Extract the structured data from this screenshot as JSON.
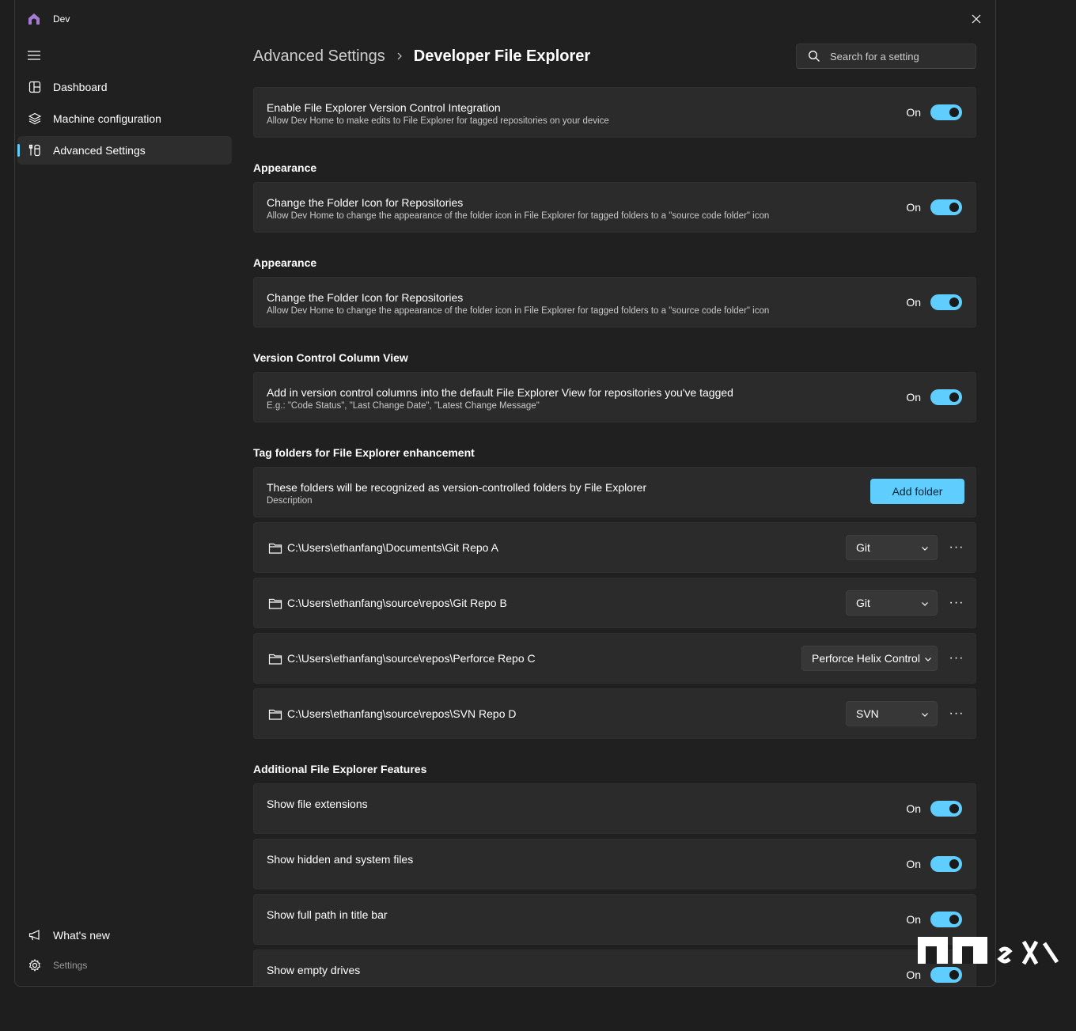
{
  "app": {
    "title": "Dev",
    "icon_color": "#a57bd7",
    "accent": "#60cdff"
  },
  "nav": {
    "items": [
      {
        "label": "Dashboard",
        "icon": "dashboard-icon"
      },
      {
        "label": "Machine configuration",
        "icon": "layers-icon"
      },
      {
        "label": "Advanced Settings",
        "icon": "tools-icon",
        "active": true
      }
    ],
    "bottom": [
      {
        "label": "What's new",
        "icon": "megaphone-icon"
      },
      {
        "label": "Settings",
        "icon": "gear-icon"
      }
    ]
  },
  "header": {
    "breadcrumb_parent": "Advanced Settings",
    "breadcrumb_current": "Developer File Explorer",
    "search_placeholder": "Search for a setting"
  },
  "main": {
    "vc_integration": {
      "title": "Enable File Explorer Version Control Integration",
      "desc": "Allow Dev Home to make edits to File Explorer for tagged repositories on your device",
      "state": "On"
    },
    "appearance1": {
      "heading": "Appearance",
      "title": "Change the Folder Icon for Repositories",
      "desc": "Allow Dev Home to change the appearance of the folder icon in File Explorer for tagged folders to a \"source code folder\" icon",
      "state": "On"
    },
    "appearance2": {
      "heading": "Appearance",
      "title": "Change the Folder Icon for Repositories",
      "desc": "Allow Dev Home to change the appearance of the folder icon in File Explorer for tagged folders to a \"source code folder\" icon",
      "state": "On"
    },
    "column_view": {
      "heading": "Version Control Column View",
      "title": "Add in version control columns into the default File Explorer View for repositories you've tagged",
      "desc": "E.g.: \"Code Status\", \"Last Change Date\", \"Latest Change Message\"",
      "state": "On"
    },
    "tag_folders": {
      "heading": "Tag folders for File Explorer enhancement",
      "title": "These folders will be recognized as version-controlled folders by File Explorer",
      "desc": "Description",
      "add_label": "Add folder",
      "folders": [
        {
          "path": "C:\\Users\\ethanfang\\Documents\\Git Repo A",
          "vc": "Git"
        },
        {
          "path": "C:\\Users\\ethanfang\\source\\repos\\Git Repo B",
          "vc": "Git"
        },
        {
          "path": "C:\\Users\\ethanfang\\source\\repos\\Perforce Repo C",
          "vc": "Perforce Helix Control"
        },
        {
          "path": "C:\\Users\\ethanfang\\source\\repos\\SVN Repo D",
          "vc": "SVN"
        }
      ],
      "more_label": "···"
    },
    "additional": {
      "heading": "Additional File Explorer Features",
      "items": [
        {
          "title": "Show file extensions",
          "state": "On"
        },
        {
          "title": "Show hidden and system files",
          "state": "On"
        },
        {
          "title": "Show full path in title bar",
          "state": "On"
        },
        {
          "title": "Show empty drives",
          "state": "On"
        }
      ]
    }
  }
}
